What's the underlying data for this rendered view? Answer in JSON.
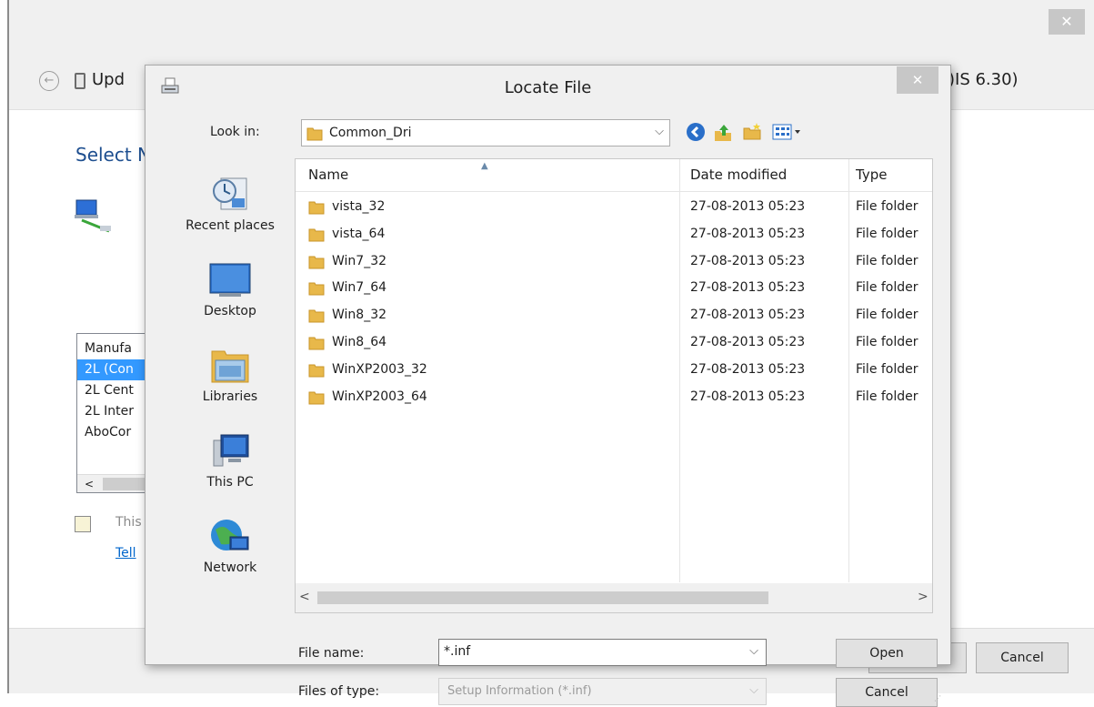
{
  "background_window": {
    "close_glyph": "✕",
    "back_glyph": "←",
    "title": "Upd",
    "title_right": ")IS 6.30)",
    "heading": "Select N",
    "manufacturer_list": {
      "header": "Manufa",
      "items": [
        "2L (Con",
        "2L Cent",
        "2L Inter",
        "AboCor"
      ],
      "selected_index": 0,
      "scroll_left_glyph": "<"
    },
    "signed_text": "This",
    "tell_link": "Tell",
    "cancel_label": "Cancel"
  },
  "dialog": {
    "title": "Locate File",
    "close_glyph": "✕",
    "look_in_label": "Look in:",
    "look_in_value": "Common_Dri",
    "dropdown_glyph": "⌵",
    "toolbar": {
      "back_glyph": "◀",
      "up_glyph": "⤴",
      "new_folder_glyph": "✚",
      "views_glyph": "▦▾"
    },
    "places": [
      {
        "label": "Recent places",
        "icon": "recent-places-icon"
      },
      {
        "label": "Desktop",
        "icon": "desktop-icon"
      },
      {
        "label": "Libraries",
        "icon": "libraries-icon"
      },
      {
        "label": "This PC",
        "icon": "this-pc-icon"
      },
      {
        "label": "Network",
        "icon": "network-icon"
      }
    ],
    "columns": {
      "name": "Name",
      "date": "Date modified",
      "type": "Type",
      "sort_glyph": "▲"
    },
    "files": [
      {
        "name": "vista_32",
        "date": "27-08-2013 05:23",
        "type": "File folder"
      },
      {
        "name": "vista_64",
        "date": "27-08-2013 05:23",
        "type": "File folder"
      },
      {
        "name": "Win7_32",
        "date": "27-08-2013 05:23",
        "type": "File folder"
      },
      {
        "name": "Win7_64",
        "date": "27-08-2013 05:23",
        "type": "File folder"
      },
      {
        "name": "Win8_32",
        "date": "27-08-2013 05:23",
        "type": "File folder"
      },
      {
        "name": "Win8_64",
        "date": "27-08-2013 05:23",
        "type": "File folder"
      },
      {
        "name": "WinXP2003_32",
        "date": "27-08-2013 05:23",
        "type": "File folder"
      },
      {
        "name": "WinXP2003_64",
        "date": "27-08-2013 05:23",
        "type": "File folder"
      }
    ],
    "scroll_left_glyph": "<",
    "scroll_right_glyph": ">",
    "file_name_label": "File name:",
    "file_name_value": "*.inf",
    "files_of_type_label": "Files of type:",
    "files_of_type_value": "Setup Information (*.inf)",
    "open_label": "Open",
    "cancel_label": "Cancel"
  },
  "colors": {
    "selection": "#3399ff",
    "link": "#0066cc",
    "heading": "#1d4e8f",
    "folder": "#e8b84a"
  }
}
